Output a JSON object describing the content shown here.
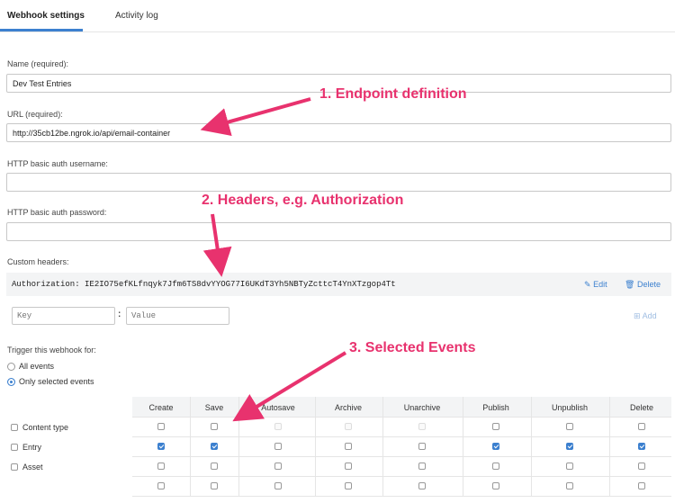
{
  "tabs": [
    {
      "label": "Webhook settings",
      "active": true
    },
    {
      "label": "Activity log",
      "active": false
    }
  ],
  "form": {
    "name_label": "Name (required):",
    "name_value": "Dev Test Entries",
    "url_label": "URL (required):",
    "url_value": "http://35cb12be.ngrok.io/api/email-container",
    "auth_user_label": "HTTP basic auth username:",
    "auth_user_value": "",
    "auth_pass_label": "HTTP basic auth password:",
    "auth_pass_value": "",
    "custom_headers_label": "Custom headers:"
  },
  "headers": {
    "existing": "Authorization: IE2IO75efKLfnqyk7Jfm6TS8dvYYOG77I6UKdT3Yh5NBTyZcttcT4YnXTzgop4Tt",
    "edit_label": "Edit",
    "delete_label": "Delete",
    "key_placeholder": "Key",
    "value_placeholder": "Value",
    "add_label": "Add"
  },
  "trigger": {
    "label": "Trigger this webhook for:",
    "options": [
      {
        "label": "All events",
        "selected": false
      },
      {
        "label": "Only selected events",
        "selected": true
      }
    ]
  },
  "events": {
    "columns": [
      "Create",
      "Save",
      "Autosave",
      "Archive",
      "Unarchive",
      "Publish",
      "Unpublish",
      "Delete"
    ],
    "rows": [
      {
        "label": "Content type",
        "checked": [
          false,
          false,
          false,
          false,
          false,
          false,
          false,
          false
        ],
        "disabled": [
          false,
          false,
          true,
          true,
          true,
          false,
          false,
          false
        ]
      },
      {
        "label": "Entry",
        "checked": [
          true,
          true,
          false,
          false,
          false,
          true,
          true,
          true
        ],
        "disabled": [
          false,
          false,
          false,
          false,
          false,
          false,
          false,
          false
        ]
      },
      {
        "label": "Asset",
        "checked": [
          false,
          false,
          false,
          false,
          false,
          false,
          false,
          false
        ],
        "disabled": [
          false,
          false,
          false,
          false,
          false,
          false,
          false,
          false
        ]
      },
      {
        "label": "",
        "checked": [
          false,
          false,
          false,
          false,
          false,
          false,
          false,
          false
        ],
        "disabled": [
          false,
          false,
          false,
          false,
          false,
          false,
          false,
          false
        ]
      }
    ]
  },
  "annotations": {
    "a1": "1. Endpoint definition",
    "a2": "2. Headers, e.g. Authorization",
    "a3": "3. Selected Events"
  },
  "colors": {
    "accent": "#3c80cf",
    "annotation": "#e8326e"
  },
  "icons": {
    "edit": "pencil-icon",
    "delete": "trash-icon",
    "add": "plus-square-icon"
  }
}
